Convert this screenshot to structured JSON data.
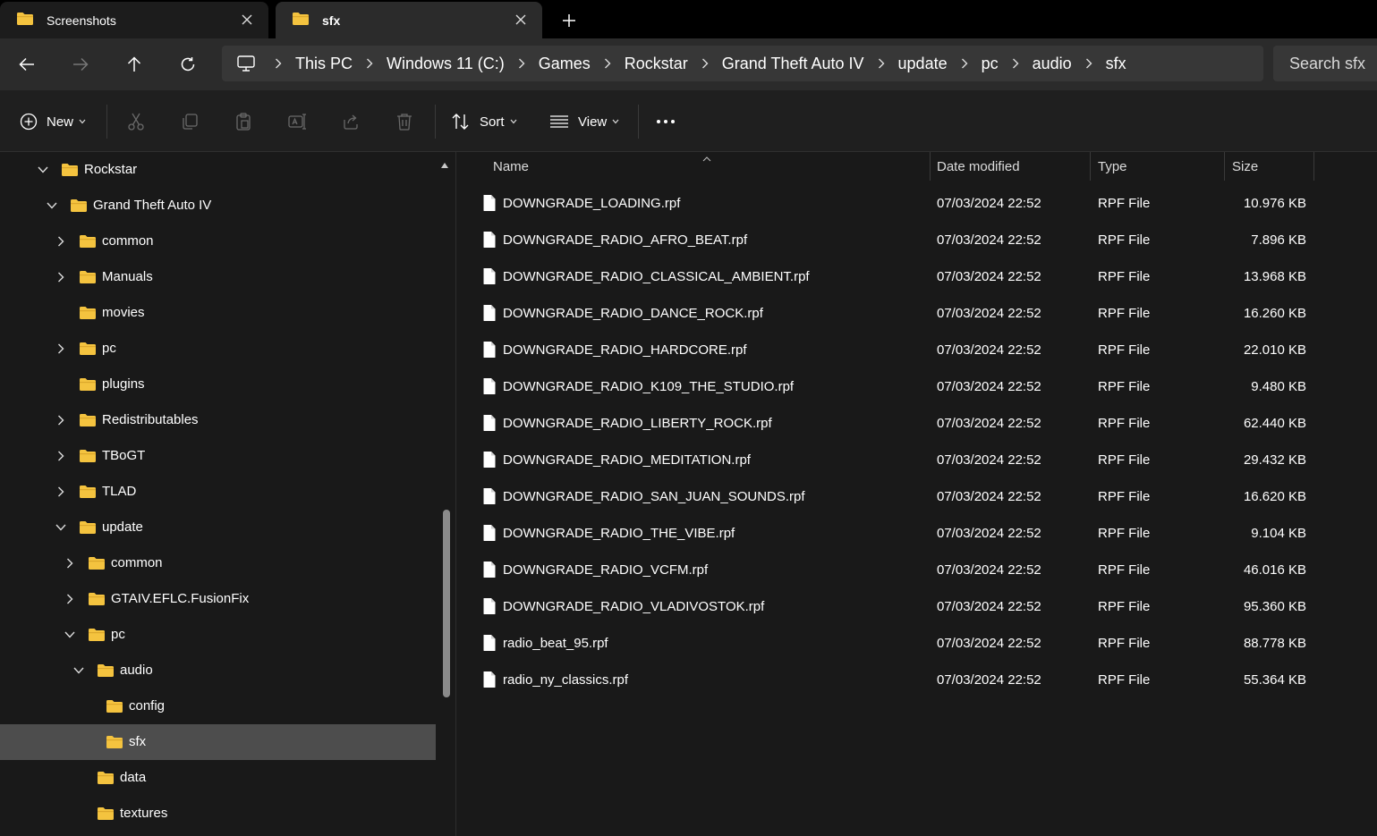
{
  "colors": {
    "folder": "#f4c33f",
    "folder_dark": "#dca72c",
    "selected": "#4d4d4d",
    "background": "#191919"
  },
  "tabs": [
    {
      "label": "Screenshots",
      "icon": "folder-icon"
    },
    {
      "label": "sfx",
      "icon": "folder-icon"
    }
  ],
  "address": {
    "crumbs": [
      "This PC",
      "Windows 11 (C:)",
      "Games",
      "Rockstar",
      "Grand Theft Auto IV",
      "update",
      "pc",
      "audio",
      "sfx"
    ],
    "search_placeholder": "Search sfx"
  },
  "commandbar": {
    "new_label": "New",
    "sort_label": "Sort",
    "view_label": "View"
  },
  "sidebar": {
    "items": [
      {
        "label": "Rockstar",
        "expanded": true
      },
      {
        "label": "Grand Theft Auto IV",
        "expanded": true
      },
      {
        "label": "common",
        "expanded": false
      },
      {
        "label": "Manuals",
        "expanded": false
      },
      {
        "label": "movies"
      },
      {
        "label": "pc",
        "expanded": false
      },
      {
        "label": "plugins"
      },
      {
        "label": "Redistributables",
        "expanded": false
      },
      {
        "label": "TBoGT",
        "expanded": false
      },
      {
        "label": "TLAD",
        "expanded": false
      },
      {
        "label": "update",
        "expanded": true
      },
      {
        "label": "common",
        "expanded": false
      },
      {
        "label": "GTAIV.EFLC.FusionFix",
        "expanded": false
      },
      {
        "label": "pc",
        "expanded": true
      },
      {
        "label": "audio",
        "expanded": true
      },
      {
        "label": "config"
      },
      {
        "label": "sfx",
        "selected": true
      },
      {
        "label": "data"
      },
      {
        "label": "textures"
      }
    ]
  },
  "filelist": {
    "columns": {
      "name": "Name",
      "date": "Date modified",
      "type": "Type",
      "size": "Size"
    },
    "rows": [
      {
        "name": "DOWNGRADE_LOADING.rpf",
        "date": "07/03/2024 22:52",
        "type": "RPF File",
        "size": "10.976 KB"
      },
      {
        "name": "DOWNGRADE_RADIO_AFRO_BEAT.rpf",
        "date": "07/03/2024 22:52",
        "type": "RPF File",
        "size": "7.896 KB"
      },
      {
        "name": "DOWNGRADE_RADIO_CLASSICAL_AMBIENT.rpf",
        "date": "07/03/2024 22:52",
        "type": "RPF File",
        "size": "13.968 KB"
      },
      {
        "name": "DOWNGRADE_RADIO_DANCE_ROCK.rpf",
        "date": "07/03/2024 22:52",
        "type": "RPF File",
        "size": "16.260 KB"
      },
      {
        "name": "DOWNGRADE_RADIO_HARDCORE.rpf",
        "date": "07/03/2024 22:52",
        "type": "RPF File",
        "size": "22.010 KB"
      },
      {
        "name": "DOWNGRADE_RADIO_K109_THE_STUDIO.rpf",
        "date": "07/03/2024 22:52",
        "type": "RPF File",
        "size": "9.480 KB"
      },
      {
        "name": "DOWNGRADE_RADIO_LIBERTY_ROCK.rpf",
        "date": "07/03/2024 22:52",
        "type": "RPF File",
        "size": "62.440 KB"
      },
      {
        "name": "DOWNGRADE_RADIO_MEDITATION.rpf",
        "date": "07/03/2024 22:52",
        "type": "RPF File",
        "size": "29.432 KB"
      },
      {
        "name": "DOWNGRADE_RADIO_SAN_JUAN_SOUNDS.rpf",
        "date": "07/03/2024 22:52",
        "type": "RPF File",
        "size": "16.620 KB"
      },
      {
        "name": "DOWNGRADE_RADIO_THE_VIBE.rpf",
        "date": "07/03/2024 22:52",
        "type": "RPF File",
        "size": "9.104 KB"
      },
      {
        "name": "DOWNGRADE_RADIO_VCFM.rpf",
        "date": "07/03/2024 22:52",
        "type": "RPF File",
        "size": "46.016 KB"
      },
      {
        "name": "DOWNGRADE_RADIO_VLADIVOSTOK.rpf",
        "date": "07/03/2024 22:52",
        "type": "RPF File",
        "size": "95.360 KB"
      },
      {
        "name": "radio_beat_95.rpf",
        "date": "07/03/2024 22:52",
        "type": "RPF File",
        "size": "88.778 KB"
      },
      {
        "name": "radio_ny_classics.rpf",
        "date": "07/03/2024 22:52",
        "type": "RPF File",
        "size": "55.364 KB"
      }
    ]
  }
}
